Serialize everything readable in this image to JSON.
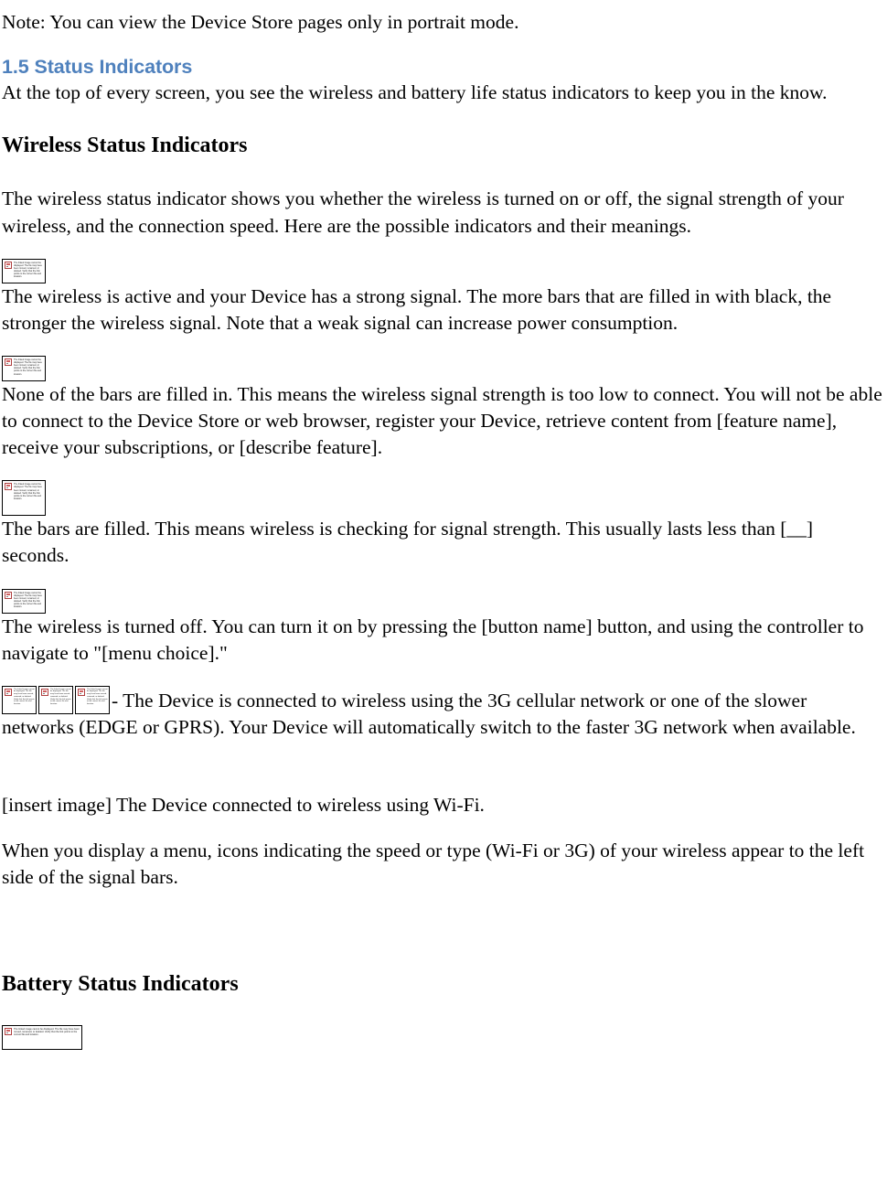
{
  "document": {
    "note_paragraph": "Note: You can view the Device Store pages only in portrait mode.",
    "section_heading": "1.5 Status Indicators",
    "section_heading_color": "#4F81BD",
    "section_intro": "At the top of every screen, you see the wireless and battery life status indicators to keep you in the know.",
    "wireless_heading": "Wireless Status Indicators",
    "wireless_intro": "The wireless status indicator shows you whether the wireless is turned on or off, the signal strength of your wireless, and the connection speed. Here are the possible indicators and their meanings.",
    "strong_signal_text": "The wireless is active and your Device has a strong signal. The more bars that are filled in with black, the stronger the wireless signal. Note that a weak signal can increase power consumption.",
    "no_signal_text": "None of the bars are filled in. This means the wireless signal strength is too low to connect. You will not be able to connect to the Device Store or web browser, register your Device, retrieve content from [feature name], receive your subscriptions, or [describe feature].",
    "checking_text": "The bars are filled. This means wireless is checking for signal strength. This usually lasts less than [__] seconds.",
    "wireless_off_text": "The wireless is turned off. You can turn it on by pressing the [button name] button, and using the controller to navigate to \"[menu choice].\"",
    "cellular_text": "- The Device is connected to wireless using the 3G cellular network or one of the slower networks (EDGE or GPRS). Your Device will automatically switch to the faster 3G network when available.",
    "wifi_text": "[insert image] The Device connected to wireless using Wi-Fi.",
    "menu_icons_text": "When you display a menu, icons indicating the speed or type (Wi-Fi or 3G) of your wireless appear to the left side of the signal bars.",
    "battery_heading": "Battery Status Indicators"
  },
  "placeholders": {
    "broken_image_alt": "The linked image cannot be displayed. The file may have been moved, renamed, or deleted. Verify that the link points to the correct file and location.",
    "glyph_name": "broken-image-icon"
  }
}
